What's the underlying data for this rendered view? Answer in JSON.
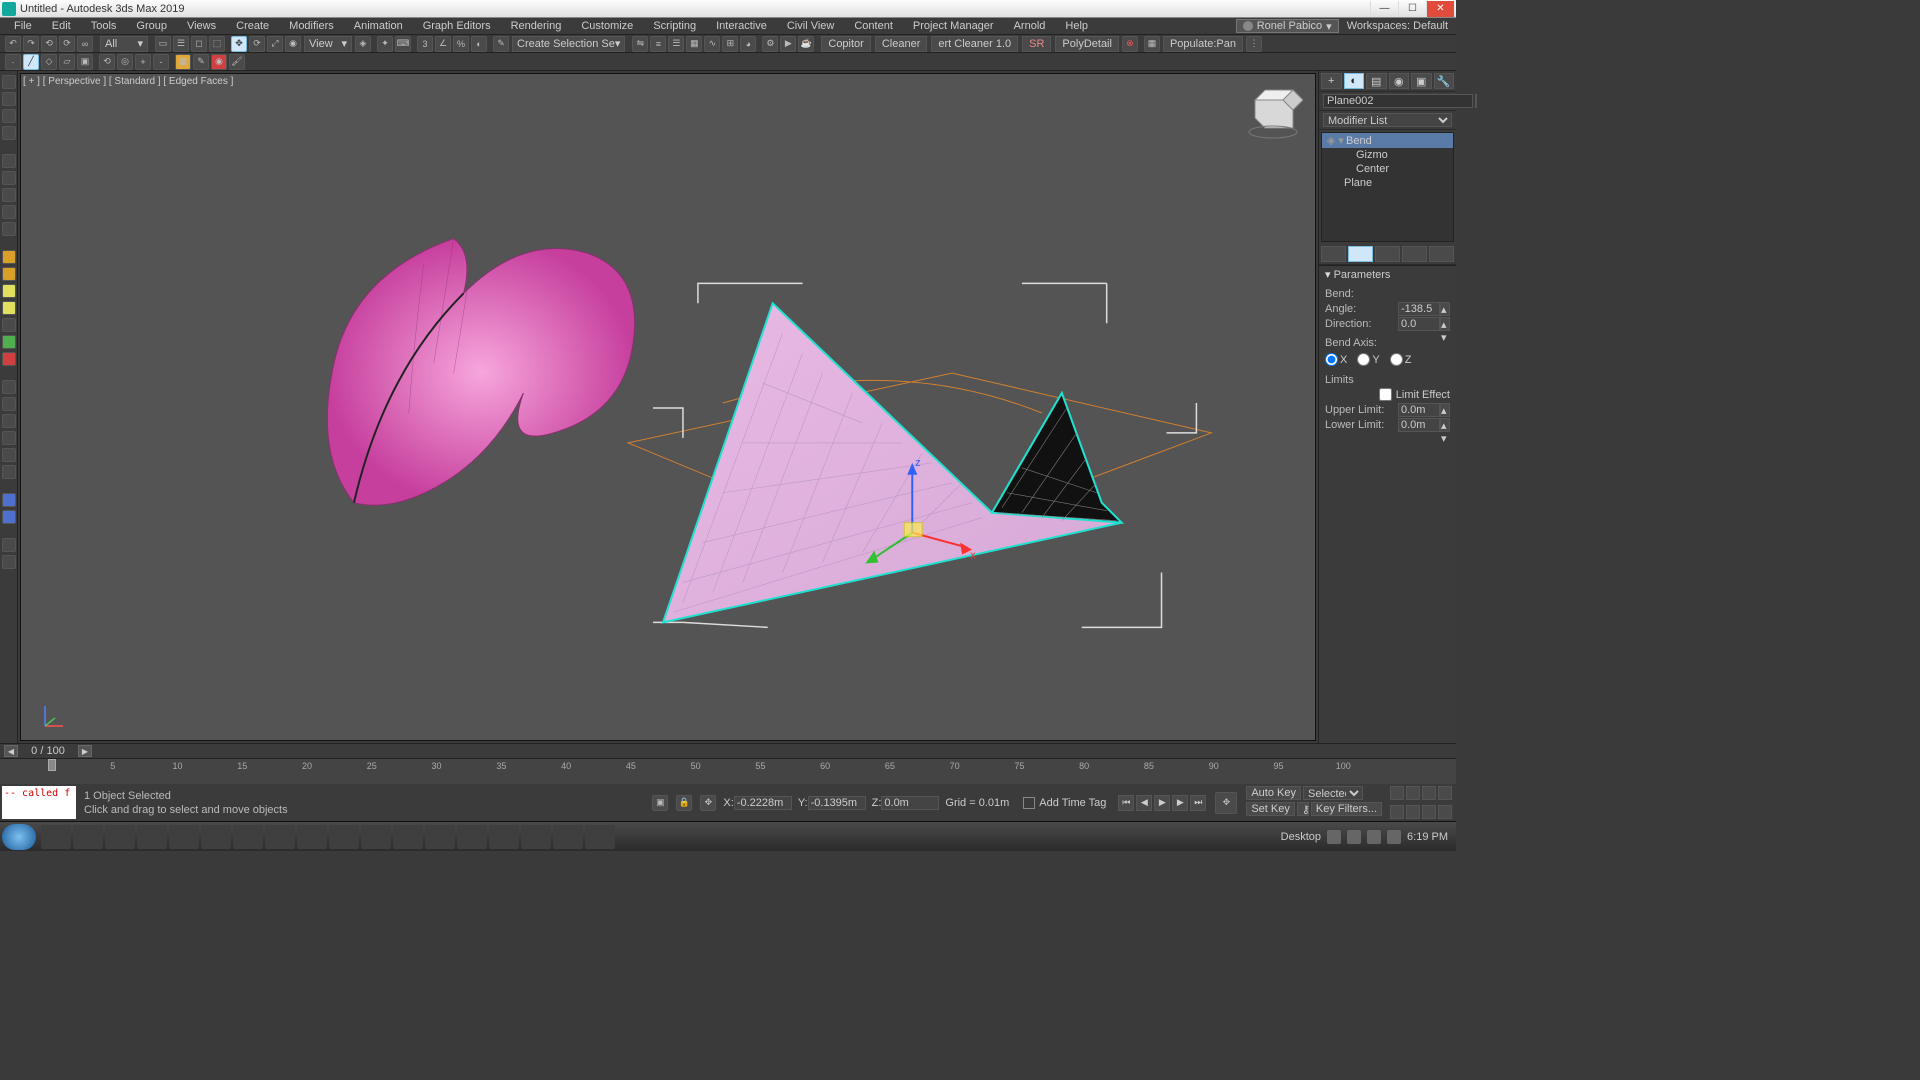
{
  "window": {
    "title": "Untitled - Autodesk 3ds Max 2019"
  },
  "user": {
    "name": "Ronel Pabico"
  },
  "workspace": {
    "label": "Workspaces:",
    "value": "Default"
  },
  "menu": [
    "File",
    "Edit",
    "Tools",
    "Group",
    "Views",
    "Create",
    "Modifiers",
    "Animation",
    "Graph Editors",
    "Rendering",
    "Customize",
    "Scripting",
    "Interactive",
    "Civil View",
    "Content",
    "Project Manager",
    "Arnold",
    "Help"
  ],
  "toolbar1": {
    "selection_filter": "All",
    "view_mode": "View",
    "selection_set": "Create Selection Se",
    "scripts": [
      "Copitor",
      "Cleaner",
      "ert Cleaner 1.0",
      "SR",
      "PolyDetail",
      "Populate:Pan"
    ]
  },
  "viewport": {
    "label": "[ + ] [ Perspective ] [ Standard ] [ Edged Faces ]"
  },
  "command_panel": {
    "object_name": "Plane002",
    "modifier_list_label": "Modifier List",
    "stack": [
      {
        "name": "Bend",
        "selected": true
      },
      {
        "name": "Gizmo",
        "indent": 2
      },
      {
        "name": "Center",
        "indent": 2
      },
      {
        "name": "Plane",
        "indent": 1
      }
    ],
    "rollout_title": "Parameters",
    "bend": {
      "section": "Bend:",
      "angle_label": "Angle:",
      "angle": "-138.5",
      "direction_label": "Direction:",
      "direction": "0.0",
      "axis_label": "Bend Axis:",
      "axis": "X",
      "limits_label": "Limits",
      "limit_effect": "Limit Effect",
      "upper_label": "Upper Limit:",
      "upper": "0.0m",
      "lower_label": "Lower Limit:",
      "lower": "0.0m"
    }
  },
  "timeline": {
    "position": "0 / 100",
    "ticks": [
      5,
      10,
      15,
      20,
      25,
      30,
      35,
      40,
      45,
      50,
      55,
      60,
      65,
      70,
      75,
      80,
      85,
      90,
      95,
      100
    ]
  },
  "status": {
    "script_output": "-- called f",
    "selection": "1 Object Selected",
    "hint": "Click and drag to select and move objects",
    "x_label": "X:",
    "x": "-0.2228m",
    "y_label": "Y:",
    "y": "-0.1395m",
    "z_label": "Z:",
    "z": "0.0m",
    "grid": "Grid = 0.01m",
    "add_time_tag": "Add Time Tag",
    "auto_key": "Auto Key",
    "set_key": "Set Key",
    "key_mode": "Selected",
    "key_filters": "Key Filters..."
  },
  "taskbar": {
    "desktop": "Desktop",
    "time": "6:19 PM"
  }
}
